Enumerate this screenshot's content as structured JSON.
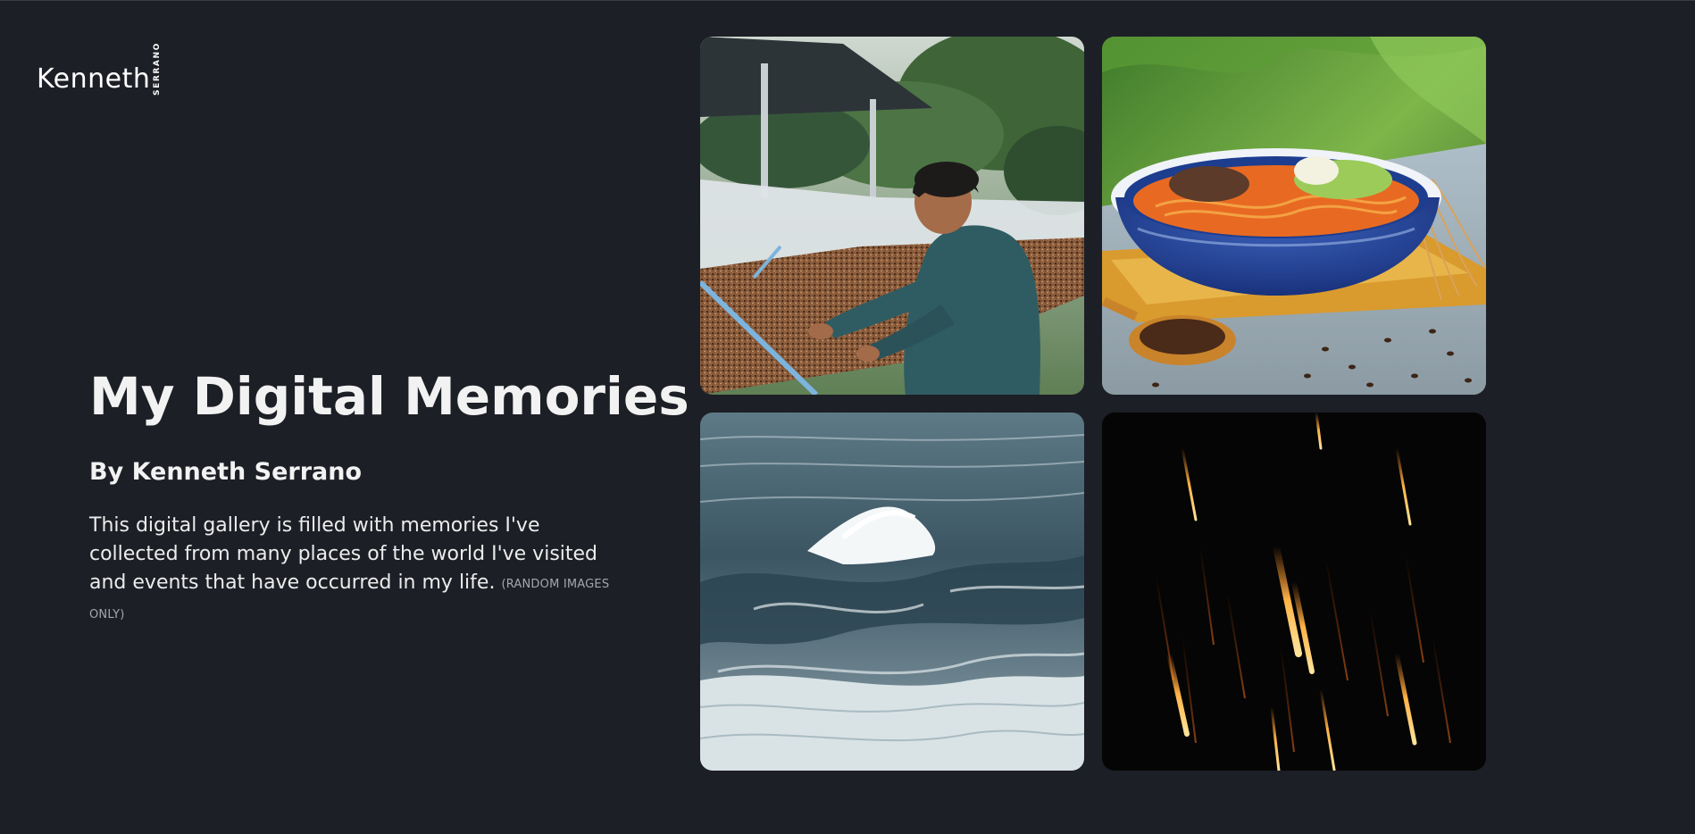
{
  "logo": {
    "name": "Kenneth",
    "surname": "SERRANO"
  },
  "hero": {
    "title": "My Digital Memories",
    "byline": "By Kenneth Serrano",
    "description": "This digital gallery is filled with memories I've collected from many places of the world I've visited and events that have occurred in my life.",
    "note": "(RANDOM IMAGES ONLY)"
  },
  "gallery": {
    "images": [
      "man-sorting-coffee-beans",
      "noodle-bowl-with-coffee-beans",
      "ocean-wave",
      "sparks-long-exposure"
    ]
  },
  "colors": {
    "background": "#1d1f26",
    "text": "#f2f2f2",
    "note": "#a3a6ad"
  }
}
